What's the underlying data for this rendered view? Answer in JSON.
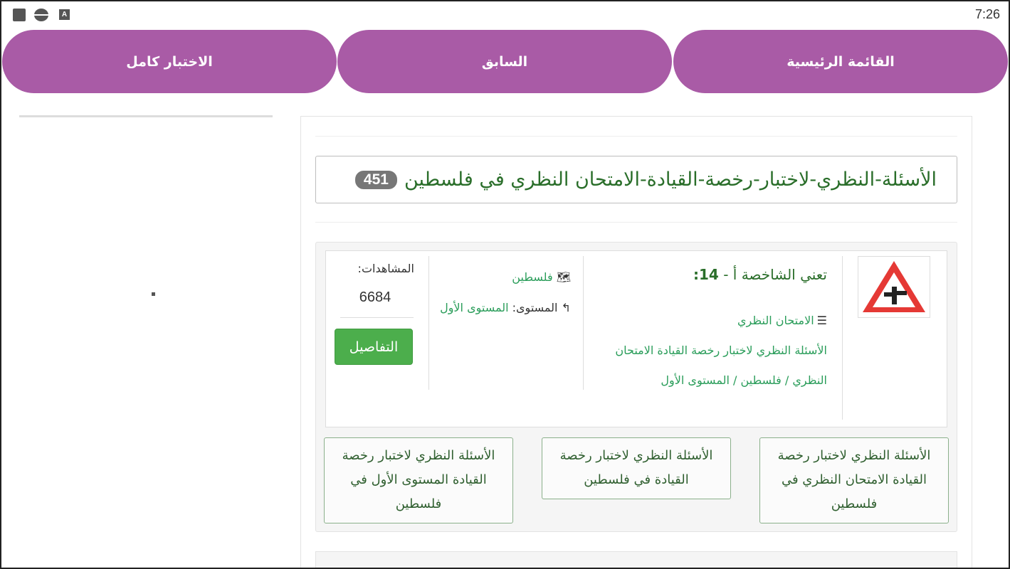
{
  "status_bar": {
    "time": "7:26",
    "icons": [
      "square-icon",
      "circle-icon",
      "a-icon"
    ]
  },
  "nav": {
    "main_menu": "القائمة الرئيسية",
    "previous": "السابق",
    "full_test": "الاختبار كامل"
  },
  "page": {
    "title": "الأسئلة-النظري-لاختبار-رخصة-القيادة-الامتحان النظري في فلسطين",
    "count": "451"
  },
  "item": {
    "title_prefix": "تعني الشاخصة أ - ",
    "title_number": "14:",
    "category_icon": "list-icon",
    "category_main": "الامتحان النظري",
    "category_path": "الأسئلة النظري لاختبار رخصة القيادة الامتحان النظري / فلسطين / المستوى الأول",
    "region_icon": "map-icon",
    "region": "فلسطين",
    "level_icon": "level-arrow-icon",
    "level_label": "المستوى:",
    "level_value": "المستوى الأول",
    "views_label": "المشاهدات:",
    "views": "6684",
    "details_button": "التفاصيل",
    "sign_image": "triangle-warning-sign-icon"
  },
  "tags": [
    "الأسئلة النظري لاختبار رخصة القيادة الامتحان النظري في فلسطين",
    "الأسئلة النظري لاختبار رخصة القيادة في فلسطين",
    "الأسئلة النظري لاختبار رخصة القيادة المستوى الأول في فلسطين"
  ],
  "colors": {
    "nav_purple": "#a95ba6",
    "title_green": "#2a6e2a",
    "link_green": "#2a9d5a",
    "button_green": "#4cae4c",
    "badge_gray": "#777777",
    "sign_red": "#e53935"
  }
}
